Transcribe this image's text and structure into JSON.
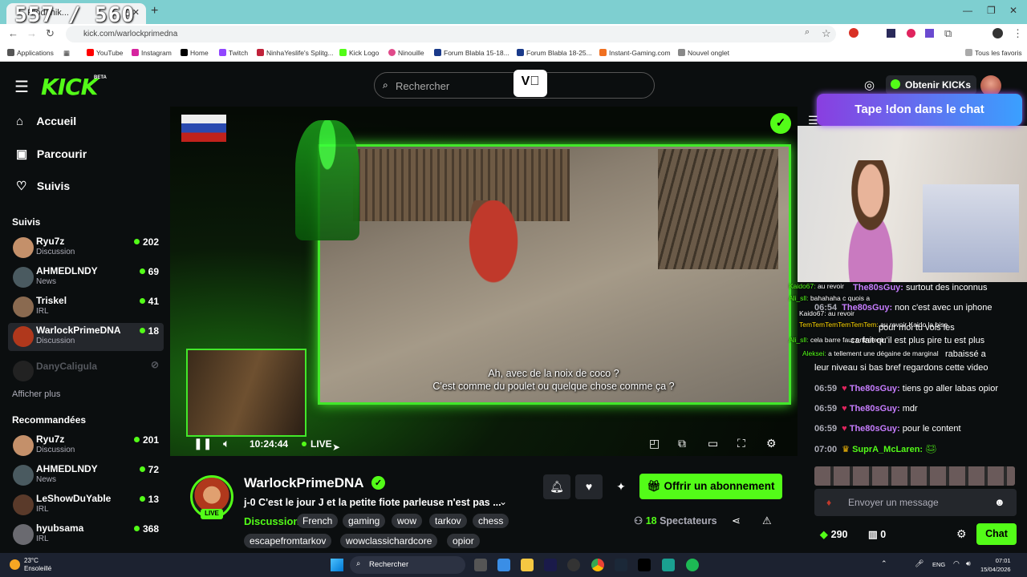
{
  "browser": {
    "counter": "557 / 560",
    "tab_title": "Rlod/ hik...",
    "url": "kick.com/warlockprimedna",
    "bookmarks": [
      "Applications",
      "YouTube",
      "Instagram",
      "Home",
      "Twitch",
      "NinhaYeslife's Splitg...",
      "Kick Logo",
      "Ninouille",
      "Forum Blabla 15-18...",
      "Forum Blabla 18-25...",
      "Instant-Gaming.com",
      "Nouvel onglet"
    ],
    "all_bookmarks": "Tous les favoris"
  },
  "header": {
    "logo": "KICK",
    "beta": "BETA",
    "search_placeholder": "Rechercher",
    "kicks_label": "Obtenir KICKs",
    "vimeo": "V⃞"
  },
  "sidebar": {
    "nav": [
      {
        "label": "Accueil",
        "icon": "⌂"
      },
      {
        "label": "Parcourir",
        "icon": "▣"
      },
      {
        "label": "Suivis",
        "icon": "♡"
      }
    ],
    "followed_title": "Suivis",
    "followed": [
      {
        "name": "Ryu7z",
        "cat": "Discussion",
        "viewers": "202",
        "color": "#c4906a"
      },
      {
        "name": "AHMEDLNDY",
        "cat": "News",
        "viewers": "69",
        "color": "#4a5a60"
      },
      {
        "name": "Triskel",
        "cat": "IRL",
        "viewers": "41",
        "color": "#8a6a50"
      },
      {
        "name": "WarlockPrimeDNA",
        "cat": "Discussion",
        "viewers": "18",
        "color": "#b0381c"
      },
      {
        "name": "DanyCaligula",
        "cat": "",
        "viewers": "",
        "color": "#333"
      }
    ],
    "show_more": "Afficher plus",
    "recommended_title": "Recommandées",
    "recommended": [
      {
        "name": "Ryu7z",
        "cat": "Discussion",
        "viewers": "201",
        "color": "#c4906a"
      },
      {
        "name": "AHMEDLNDY",
        "cat": "News",
        "viewers": "72",
        "color": "#4a5a60"
      },
      {
        "name": "LeShowDuYable",
        "cat": "IRL",
        "viewers": "13",
        "color": "#5a3a2a"
      },
      {
        "name": "hyubsama",
        "cat": "IRL",
        "viewers": "368",
        "color": "#6a6a70"
      }
    ]
  },
  "player": {
    "subtitle_l1": "Ah, avec de la noix de coco ?",
    "subtitle_l2": "C'est comme du poulet ou quelque chose comme ça ?",
    "time": "10:24:44",
    "live": "LIVE"
  },
  "stream": {
    "channel": "WarlockPrimeDNA",
    "live_badge": "LIVE",
    "title": "j-0 C'est le jour J et la petite fiote parleuse n'est pas ...",
    "category": "Discussion",
    "tags": [
      "French",
      "gaming",
      "wow",
      "tarkov",
      "chess",
      "escapefromtarkov",
      "wowclassichardcore",
      "opior"
    ],
    "subscribe": "Offrir un abonnement",
    "viewers_count": "18",
    "viewers_label": "Spectateurs"
  },
  "chat": {
    "banner": "Tape !don dans le chat",
    "overlay": [
      {
        "u": "Kaido67:",
        "m": "au revoir"
      },
      {
        "u": "Ali_sll:",
        "m": "bahahaha c quois a"
      },
      {
        "u": "Kaido67:",
        "m": "au revoir"
      },
      {
        "u": "TemTemTemTemTemTem:",
        "m": "au revoir Kaido la bise"
      },
      {
        "u": "Ali_sll:",
        "m": "cela barre faut entretenir"
      },
      {
        "u": "Aleksei:",
        "m": "a tellement une dégaine de marginal"
      }
    ],
    "messages": [
      {
        "t": "",
        "u": "The80sGuy:",
        "m": "surtout des inconnus"
      },
      {
        "t": "06:54",
        "u": "The80sGuy:",
        "m": "non c'est avec un iphone"
      },
      {
        "t": "",
        "u": "",
        "m": "pour moi tu vois les"
      },
      {
        "t": "",
        "u": "",
        "m": "ca fait qu'il est plus pire tu est plus"
      },
      {
        "t": "",
        "u": "",
        "m": "rabaissé a"
      },
      {
        "t": "",
        "u": "",
        "m": "leur niveau si bas bref regardons cette video"
      },
      {
        "t": "06:59",
        "u": "The80sGuy:",
        "m": "tiens go aller labas opior"
      },
      {
        "t": "06:59",
        "u": "The80sGuy:",
        "m": "mdr"
      },
      {
        "t": "06:59",
        "u": "The80sGuy:",
        "m": "pour le content"
      },
      {
        "t": "07:00",
        "u": "SuprA_McLaren:",
        "m": ""
      }
    ],
    "placeholder": "Envoyer un message",
    "points": "290",
    "gifts": "0",
    "send": "Chat"
  },
  "taskbar": {
    "temp": "23°C",
    "weather": "Ensoleillé",
    "search": "Rechercher",
    "lang": "ENG",
    "time": "07:01",
    "date": "15/04/2026"
  }
}
